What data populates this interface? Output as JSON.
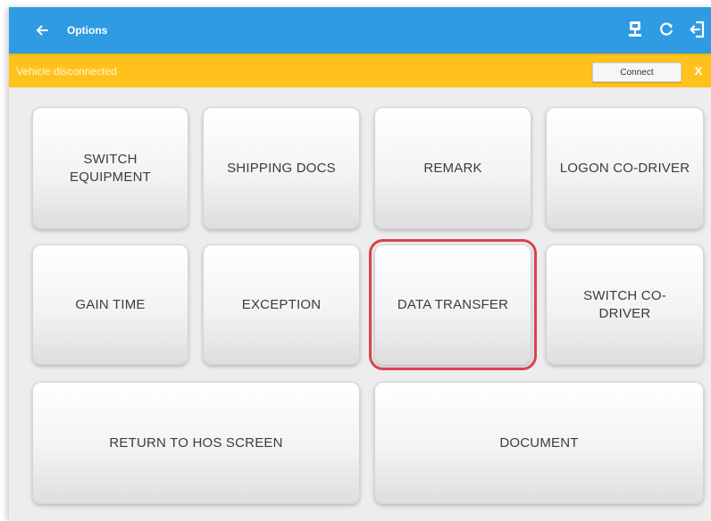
{
  "appbar": {
    "title": "Options",
    "back_icon": "arrow-left-icon",
    "actions": [
      "cloud-upload-icon",
      "refresh-icon",
      "logout-icon"
    ]
  },
  "banner": {
    "text": "Vehicle disconnected",
    "connect_label": "Connect",
    "close_label": "X"
  },
  "options": {
    "switch_equipment": "SWITCH\nEQUIPMENT",
    "shipping_docs": "SHIPPING DOCS",
    "remark": "REMARK",
    "logon_codriver": "LOGON CO-DRIVER",
    "gain_time": "GAIN TIME",
    "exception": "EXCEPTION",
    "data_transfer": "DATA TRANSFER",
    "switch_codriver": "SWITCH CO-\nDRIVER",
    "return_hos": "RETURN TO HOS SCREEN",
    "document": "DOCUMENT"
  },
  "colors": {
    "appbar": "#2f9be3",
    "banner": "#ffc21c",
    "highlight": "#d9434f",
    "background": "#ededed"
  }
}
